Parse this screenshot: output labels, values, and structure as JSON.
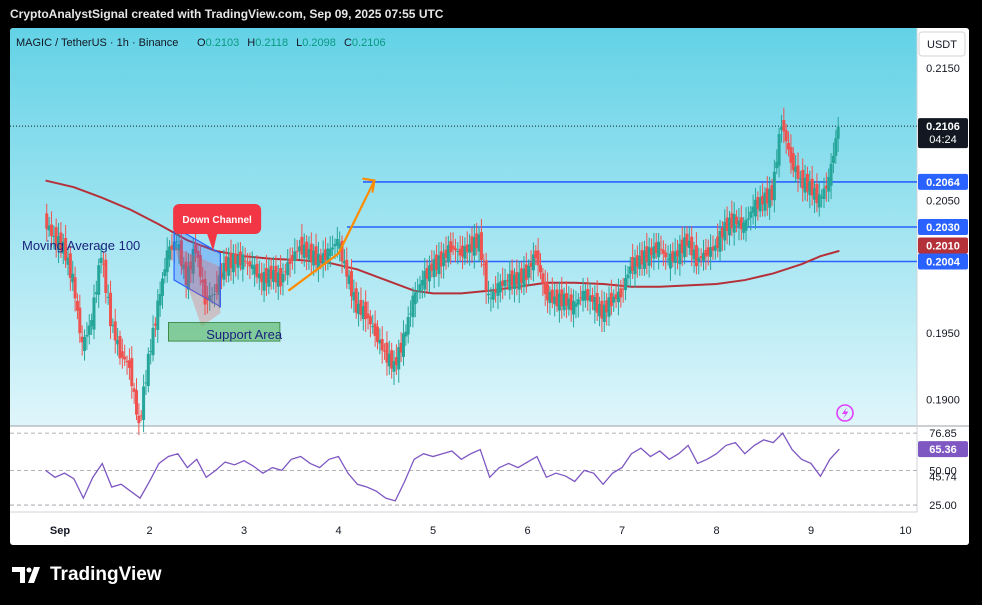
{
  "header": {
    "text": "CryptoAnalystSignal created with TradingView.com, Sep 09, 2025 07:55 UTC"
  },
  "brand": {
    "name": "TradingView"
  },
  "symbol": {
    "title": "MAGIC / TetherUS · 1h · Binance",
    "o_label": "O",
    "o_value": "0.2103",
    "h_label": "H",
    "h_value": "0.2118",
    "l_label": "L",
    "l_value": "0.2098",
    "c_label": "C",
    "c_value": "0.2106"
  },
  "currency_button": "USDT",
  "colors": {
    "up": "#26a69a",
    "down": "#ef5350",
    "ma": "#b5313a",
    "level": "#2962ff",
    "rsi": "#7e57c2",
    "arrow": "#ff8c00",
    "callout": "#f23645",
    "support": "#4caf50",
    "channel": "#2962ff",
    "bg_top": "#63d2e6",
    "bg_bottom": "#dff6fb"
  },
  "chart_data": [
    {
      "type": "candlestick",
      "ylim": [
        0.188,
        0.218
      ],
      "yticks": [
        "0.2150",
        "0.2050",
        "0.1950",
        "0.1900"
      ],
      "ytick_values": [
        0.215,
        0.205,
        0.195,
        0.19
      ],
      "x_labels": [
        "Sep",
        "2",
        "3",
        "4",
        "5",
        "6",
        "7",
        "8",
        "9",
        "10"
      ],
      "x_label_days": [
        1,
        2,
        3,
        4,
        5,
        6,
        7,
        8,
        9,
        10
      ],
      "last_price": "0.2106",
      "last_price_value": 0.2106,
      "countdown": "04:24",
      "levels": [
        {
          "label": "0.2064",
          "value": 0.2064
        },
        {
          "label": "0.2030",
          "value": 0.203
        },
        {
          "label": "0.2004",
          "value": 0.2004
        }
      ],
      "ma_label": "0.2010",
      "ma_value": 0.201,
      "annotations": {
        "moving_average": "Moving Average 100",
        "down_channel": "Down Channel",
        "support_area": "Support Area"
      },
      "series": [
        {
          "name": "Moving Average 100",
          "points": [
            [
              0.9,
              0.2065
            ],
            [
              1.2,
              0.206
            ],
            [
              1.5,
              0.2052
            ],
            [
              1.8,
              0.2043
            ],
            [
              2.1,
              0.2032
            ],
            [
              2.4,
              0.202
            ],
            [
              2.7,
              0.2012
            ],
            [
              3.0,
              0.2008
            ],
            [
              3.3,
              0.2006
            ],
            [
              3.6,
              0.2005
            ],
            [
              3.9,
              0.2003
            ],
            [
              4.2,
              0.1998
            ],
            [
              4.5,
              0.199
            ],
            [
              4.8,
              0.1982
            ],
            [
              5.0,
              0.198
            ],
            [
              5.3,
              0.198
            ],
            [
              5.6,
              0.1982
            ],
            [
              5.9,
              0.1985
            ],
            [
              6.2,
              0.1988
            ],
            [
              6.5,
              0.1988
            ],
            [
              6.8,
              0.1987
            ],
            [
              7.1,
              0.1985
            ],
            [
              7.4,
              0.1985
            ],
            [
              7.7,
              0.1986
            ],
            [
              8.0,
              0.1987
            ],
            [
              8.3,
              0.199
            ],
            [
              8.6,
              0.1995
            ],
            [
              8.9,
              0.2002
            ],
            [
              9.1,
              0.2008
            ],
            [
              9.3,
              0.2012
            ]
          ]
        },
        {
          "name": "Price",
          "points": [
            [
              0.9,
              0.2035
            ],
            [
              1.0,
              0.2022
            ],
            [
              1.1,
              0.2015
            ],
            [
              1.2,
              0.199
            ],
            [
              1.3,
              0.194
            ],
            [
              1.4,
              0.196
            ],
            [
              1.5,
              0.201
            ],
            [
              1.6,
              0.196
            ],
            [
              1.7,
              0.1935
            ],
            [
              1.8,
              0.1925
            ],
            [
              1.9,
              0.188
            ],
            [
              2.0,
              0.193
            ],
            [
              2.1,
              0.197
            ],
            [
              2.2,
              0.201
            ],
            [
              2.3,
              0.202
            ],
            [
              2.4,
              0.199
            ],
            [
              2.5,
              0.2015
            ],
            [
              2.6,
              0.1975
            ],
            [
              2.7,
              0.198
            ],
            [
              2.8,
              0.2
            ],
            [
              2.9,
              0.2005
            ],
            [
              3.0,
              0.2005
            ],
            [
              3.1,
              0.2
            ],
            [
              3.2,
              0.199
            ],
            [
              3.3,
              0.1995
            ],
            [
              3.4,
              0.199
            ],
            [
              3.5,
              0.2005
            ],
            [
              3.6,
              0.2015
            ],
            [
              3.7,
              0.201
            ],
            [
              3.8,
              0.2005
            ],
            [
              3.9,
              0.201
            ],
            [
              4.0,
              0.202
            ],
            [
              4.1,
              0.1995
            ],
            [
              4.2,
              0.197
            ],
            [
              4.3,
              0.1965
            ],
            [
              4.4,
              0.195
            ],
            [
              4.5,
              0.1935
            ],
            [
              4.6,
              0.1925
            ],
            [
              4.7,
              0.1945
            ],
            [
              4.8,
              0.1975
            ],
            [
              4.9,
              0.199
            ],
            [
              5.0,
              0.2
            ],
            [
              5.1,
              0.2005
            ],
            [
              5.2,
              0.2015
            ],
            [
              5.3,
              0.201
            ],
            [
              5.4,
              0.2015
            ],
            [
              5.5,
              0.202
            ],
            [
              5.6,
              0.1975
            ],
            [
              5.7,
              0.1985
            ],
            [
              5.8,
              0.199
            ],
            [
              5.9,
              0.199
            ],
            [
              6.0,
              0.1995
            ],
            [
              6.1,
              0.201
            ],
            [
              6.2,
              0.198
            ],
            [
              6.3,
              0.1975
            ],
            [
              6.4,
              0.1975
            ],
            [
              6.5,
              0.197
            ],
            [
              6.6,
              0.198
            ],
            [
              6.7,
              0.1975
            ],
            [
              6.8,
              0.1965
            ],
            [
              6.9,
              0.1975
            ],
            [
              7.0,
              0.198
            ],
            [
              7.1,
              0.2
            ],
            [
              7.2,
              0.2005
            ],
            [
              7.3,
              0.201
            ],
            [
              7.4,
              0.2015
            ],
            [
              7.5,
              0.2005
            ],
            [
              7.6,
              0.201
            ],
            [
              7.7,
              0.202
            ],
            [
              7.8,
              0.2005
            ],
            [
              7.9,
              0.201
            ],
            [
              8.0,
              0.2015
            ],
            [
              8.1,
              0.203
            ],
            [
              8.2,
              0.2035
            ],
            [
              8.3,
              0.203
            ],
            [
              8.4,
              0.2045
            ],
            [
              8.5,
              0.205
            ],
            [
              8.6,
              0.2055
            ],
            [
              8.7,
              0.211
            ],
            [
              8.8,
              0.208
            ],
            [
              8.9,
              0.2065
            ],
            [
              9.0,
              0.206
            ],
            [
              9.1,
              0.205
            ],
            [
              9.2,
              0.2065
            ],
            [
              9.3,
              0.2106
            ]
          ]
        }
      ]
    },
    {
      "type": "line",
      "name": "RSI",
      "ylim": [
        20,
        82
      ],
      "yticks": [
        "76.85",
        "50.00",
        "45.74",
        "25.00"
      ],
      "ytick_values": [
        76.85,
        50.0,
        45.74,
        25.0
      ],
      "current": "65.36",
      "current_value": 65.36,
      "series": [
        {
          "name": "RSI",
          "points": [
            [
              0.9,
              50
            ],
            [
              1.0,
              45
            ],
            [
              1.1,
              48
            ],
            [
              1.2,
              44
            ],
            [
              1.3,
              30
            ],
            [
              1.4,
              45
            ],
            [
              1.5,
              55
            ],
            [
              1.6,
              38
            ],
            [
              1.7,
              40
            ],
            [
              1.8,
              35
            ],
            [
              1.9,
              30
            ],
            [
              2.0,
              42
            ],
            [
              2.1,
              55
            ],
            [
              2.2,
              60
            ],
            [
              2.3,
              62
            ],
            [
              2.4,
              52
            ],
            [
              2.5,
              58
            ],
            [
              2.6,
              45
            ],
            [
              2.7,
              50
            ],
            [
              2.8,
              56
            ],
            [
              2.9,
              54
            ],
            [
              3.0,
              57
            ],
            [
              3.1,
              53
            ],
            [
              3.2,
              48
            ],
            [
              3.3,
              52
            ],
            [
              3.4,
              50
            ],
            [
              3.5,
              58
            ],
            [
              3.6,
              60
            ],
            [
              3.7,
              55
            ],
            [
              3.8,
              52
            ],
            [
              3.9,
              58
            ],
            [
              4.0,
              60
            ],
            [
              4.1,
              48
            ],
            [
              4.2,
              40
            ],
            [
              4.3,
              38
            ],
            [
              4.4,
              35
            ],
            [
              4.5,
              30
            ],
            [
              4.6,
              28
            ],
            [
              4.7,
              42
            ],
            [
              4.8,
              58
            ],
            [
              4.9,
              62
            ],
            [
              5.0,
              60
            ],
            [
              5.1,
              62
            ],
            [
              5.2,
              64
            ],
            [
              5.3,
              58
            ],
            [
              5.4,
              62
            ],
            [
              5.5,
              65
            ],
            [
              5.6,
              45
            ],
            [
              5.7,
              52
            ],
            [
              5.8,
              55
            ],
            [
              5.9,
              52
            ],
            [
              6.0,
              56
            ],
            [
              6.1,
              60
            ],
            [
              6.2,
              45
            ],
            [
              6.3,
              48
            ],
            [
              6.4,
              46
            ],
            [
              6.5,
              42
            ],
            [
              6.6,
              50
            ],
            [
              6.7,
              48
            ],
            [
              6.8,
              40
            ],
            [
              6.9,
              48
            ],
            [
              7.0,
              52
            ],
            [
              7.1,
              62
            ],
            [
              7.2,
              66
            ],
            [
              7.3,
              60
            ],
            [
              7.4,
              64
            ],
            [
              7.5,
              58
            ],
            [
              7.6,
              62
            ],
            [
              7.7,
              68
            ],
            [
              7.8,
              55
            ],
            [
              7.9,
              58
            ],
            [
              8.0,
              62
            ],
            [
              8.1,
              68
            ],
            [
              8.2,
              70
            ],
            [
              8.3,
              62
            ],
            [
              8.4,
              68
            ],
            [
              8.5,
              72
            ],
            [
              8.6,
              70
            ],
            [
              8.7,
              76.85
            ],
            [
              8.8,
              65
            ],
            [
              8.9,
              58
            ],
            [
              9.0,
              55
            ],
            [
              9.1,
              45.74
            ],
            [
              9.2,
              58
            ],
            [
              9.3,
              65.36
            ]
          ]
        }
      ]
    }
  ]
}
